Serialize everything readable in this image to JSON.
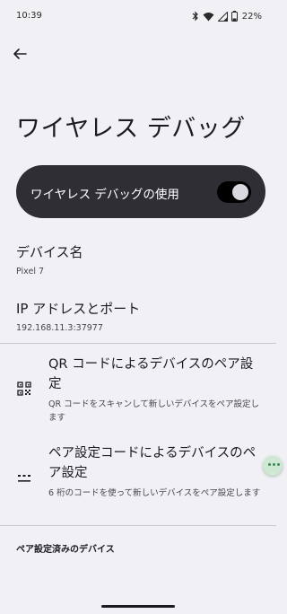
{
  "status_bar": {
    "time": "10:39",
    "battery": "22%",
    "icons": [
      "bluetooth-icon",
      "wifi-icon",
      "cell-signal-icon",
      "battery-icon"
    ]
  },
  "header": {
    "back_icon": "arrow-back-icon",
    "title": "ワイヤレス デバッグ"
  },
  "main_toggle": {
    "label": "ワイヤレス デバッグの使用",
    "checked": true
  },
  "device_name": {
    "title": "デバイス名",
    "value": "Pixel 7"
  },
  "ip_address": {
    "title": "IP アドレスとポート",
    "value": "192.168.11.3:37977"
  },
  "pair_qr": {
    "icon": "qr-code-scanner-icon",
    "title": "QR コードによるデバイスのペア設定",
    "summary": "QR コードをスキャンして新しいデバイスをペア設定します"
  },
  "pair_code": {
    "icon": "dialpad-icon",
    "title": "ペア設定コードによるデバイスのペア設定",
    "summary": "6 桁のコードを使って新しいデバイスをペア設定します"
  },
  "paired_devices": {
    "header": "ペア設定済みのデバイス"
  },
  "colors": {
    "background": "#f1f0f5",
    "toggle_card": "#2f2e35",
    "switch_track": "#000000",
    "switch_thumb": "#dad9df",
    "text_primary": "#1c1b1f",
    "text_secondary": "#47464f"
  }
}
